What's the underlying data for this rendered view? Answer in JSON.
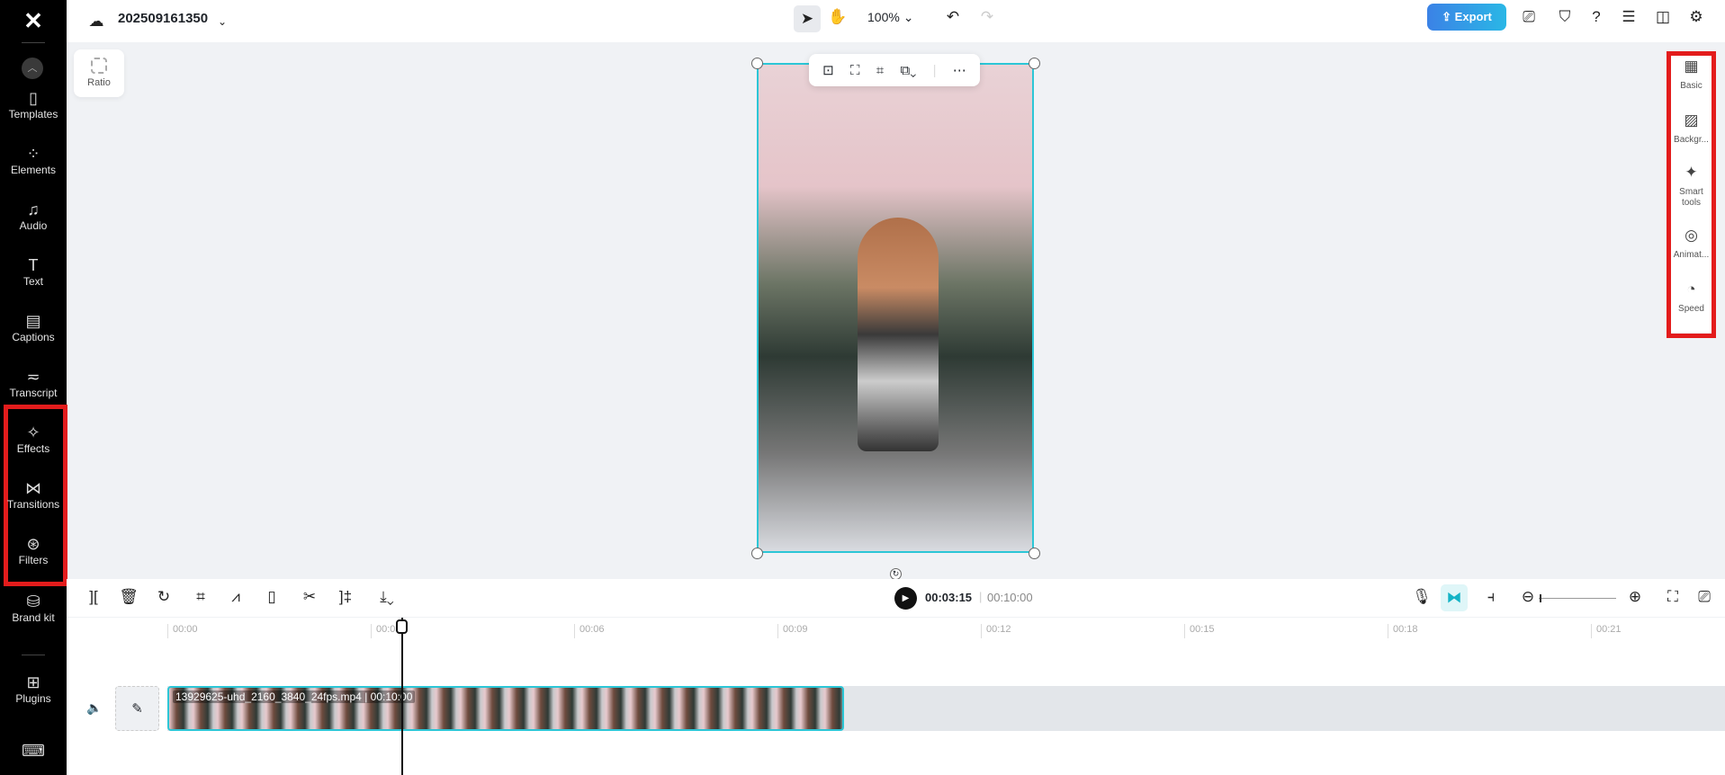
{
  "app": {
    "logo": "CapCut"
  },
  "sidebar": {
    "items": [
      {
        "label": "Templates",
        "icon": "templates-icon"
      },
      {
        "label": "Elements",
        "icon": "elements-icon"
      },
      {
        "label": "Audio",
        "icon": "audio-icon"
      },
      {
        "label": "Text",
        "icon": "text-icon"
      },
      {
        "label": "Captions",
        "icon": "captions-icon"
      },
      {
        "label": "Transcript",
        "icon": "transcript-icon"
      },
      {
        "label": "Effects",
        "icon": "effects-icon"
      },
      {
        "label": "Transitions",
        "icon": "transitions-icon"
      },
      {
        "label": "Filters",
        "icon": "filters-icon"
      },
      {
        "label": "Brand kit",
        "icon": "brand-kit-icon"
      },
      {
        "label": "Plugins",
        "icon": "plugins-icon"
      }
    ]
  },
  "header": {
    "project_name": "202509161350",
    "zoom": "100%",
    "export_label": "Export"
  },
  "canvas": {
    "ratio_label": "Ratio"
  },
  "right_panel": {
    "items": [
      {
        "label": "Basic"
      },
      {
        "label": "Backgr..."
      },
      {
        "label": "Smart tools"
      },
      {
        "label": "Animat..."
      },
      {
        "label": "Speed"
      }
    ]
  },
  "playback": {
    "current": "00:03:15",
    "separator": "|",
    "duration": "00:10:00"
  },
  "timeline": {
    "ticks": [
      "00:00",
      "00:03",
      "00:06",
      "00:09",
      "00:12",
      "00:15",
      "00:18",
      "00:21"
    ],
    "clip": {
      "name": "13929625-uhd_2160_3840_24fps.mp4",
      "duration": "00:10:00"
    }
  },
  "colors": {
    "accent": "#2cc6d6",
    "export": "#3b82e6",
    "highlight": "#e31c1c"
  }
}
